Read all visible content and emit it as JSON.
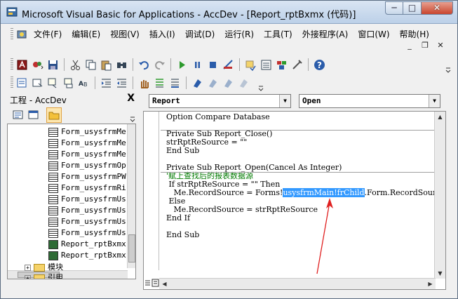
{
  "window": {
    "title": "Microsoft Visual Basic for Applications - AccDev - [Report_rptBxmx (代码)]",
    "min_glyph": "─",
    "max_glyph": "□",
    "close_glyph": "✕"
  },
  "menu": {
    "items": [
      {
        "label": "文件(F)"
      },
      {
        "label": "编辑(E)"
      },
      {
        "label": "视图(V)"
      },
      {
        "label": "插入(I)"
      },
      {
        "label": "调试(D)"
      },
      {
        "label": "运行(R)"
      },
      {
        "label": "工具(T)"
      },
      {
        "label": "外接程序(A)"
      },
      {
        "label": "窗口(W)"
      },
      {
        "label": "帮助(H)"
      }
    ],
    "mdi_min": "_",
    "mdi_restore": "❐",
    "mdi_close": "✕"
  },
  "project": {
    "title": "工程 - AccDev",
    "close_glyph": "X",
    "items": [
      {
        "label": "Form_usysfrmMe",
        "kind": "form"
      },
      {
        "label": "Form_usysfrmMe",
        "kind": "form"
      },
      {
        "label": "Form_usysfrmMe",
        "kind": "form"
      },
      {
        "label": "Form_usysfrmOp",
        "kind": "form"
      },
      {
        "label": "Form_usysfrmPW",
        "kind": "form"
      },
      {
        "label": "Form_usysfrmRi",
        "kind": "form"
      },
      {
        "label": "Form_usysfrmUs",
        "kind": "form"
      },
      {
        "label": "Form_usysfrmUs",
        "kind": "form"
      },
      {
        "label": "Form_usysfrmUs",
        "kind": "form"
      },
      {
        "label": "Form_usysfrmUs",
        "kind": "form"
      },
      {
        "label": "Report_rptBxmx",
        "kind": "report"
      },
      {
        "label": "Report_rptBxmx",
        "kind": "report"
      }
    ],
    "folders": [
      {
        "label": "模块",
        "expander": "+"
      },
      {
        "label": "引用",
        "expander": "+"
      }
    ]
  },
  "code": {
    "object_combo": "Report",
    "procedure_combo": "Open",
    "lines": [
      {
        "text": "Option Compare Database"
      },
      {
        "text": ""
      },
      {
        "text": "Private Sub Report_Close()"
      },
      {
        "text": "strRptReSource = \"\""
      },
      {
        "text": "End Sub"
      },
      {
        "text": ""
      },
      {
        "text": "Private Sub Report_Open(Cancel As Integer)"
      },
      {
        "text": "'赋上查找后的报表数据源",
        "style": "comment"
      },
      {
        "text": " If strRptReSource = \"\" Then"
      },
      {
        "pre": "   Me.RecordSource = Forms!",
        "hl": "usysfrmMain!frChild",
        "post": ".Form.RecordSource"
      },
      {
        "text": " Else"
      },
      {
        "text": "   Me.RecordSource = strRptReSource"
      },
      {
        "text": "End If"
      },
      {
        "text": ""
      },
      {
        "text": "End Sub"
      }
    ]
  },
  "annotation_color": "#e02020"
}
